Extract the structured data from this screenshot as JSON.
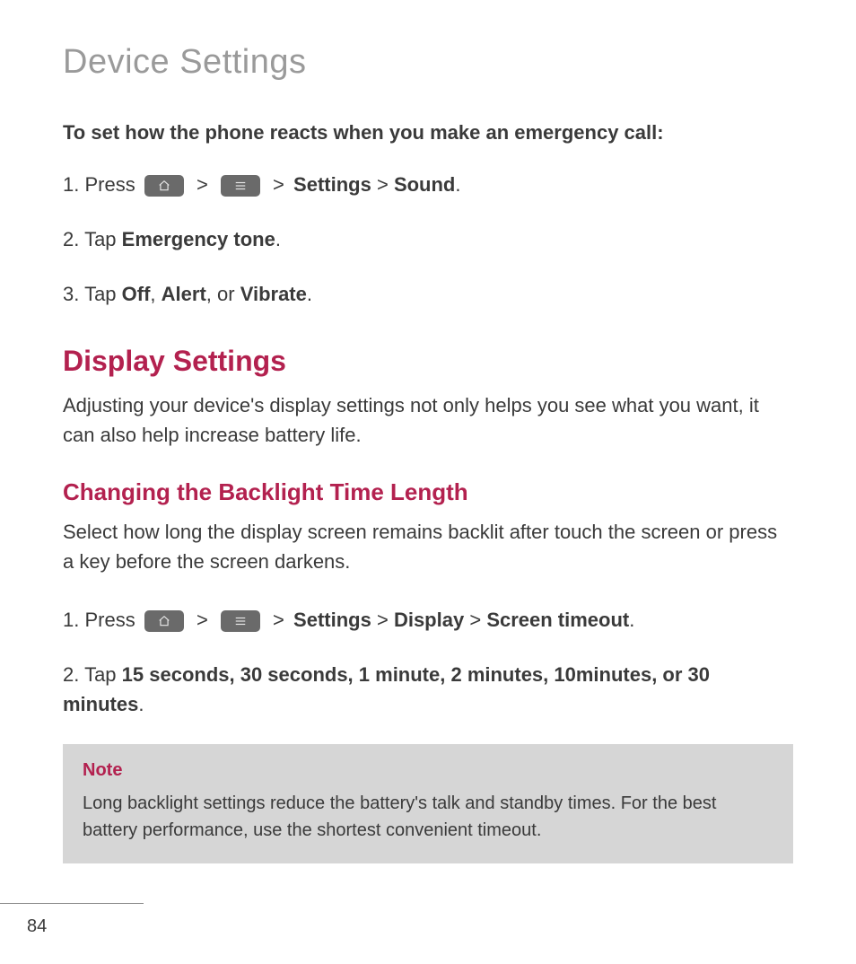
{
  "page": {
    "title": "Device Settings",
    "number": "84"
  },
  "intro": {
    "heading": "To set how the phone reacts when you make an emergency call:"
  },
  "steps1": {
    "s1_prefix": "1. Press ",
    "s1_gt1": ">",
    "s1_gt2": ">",
    "s1_settings": "Settings",
    "s1_gt3": ">",
    "s1_sound": "Sound",
    "s1_period": ".",
    "s2_prefix": "2. Tap ",
    "s2_bold": "Emergency tone",
    "s2_period": ".",
    "s3_prefix": "3. Tap ",
    "s3_off": "Off",
    "s3_comma1": ", ",
    "s3_alert": "Alert",
    "s3_comma2": ", or ",
    "s3_vibrate": "Vibrate",
    "s3_period": "."
  },
  "display": {
    "heading": "Display Settings",
    "para": "Adjusting your device's display settings not only helps you see what you want, it can also help increase battery life."
  },
  "backlight": {
    "heading": "Changing the Backlight Time Length",
    "para": "Select how long the display screen remains backlit after touch the screen or press a key before the screen darkens.",
    "s1_prefix": "1. Press ",
    "s1_gt1": ">",
    "s1_gt2": ">",
    "s1_settings": "Settings",
    "s1_gt3": ">",
    "s1_display": "Display",
    "s1_gt4": ">",
    "s1_timeout": "Screen timeout",
    "s1_period": ".",
    "s2_prefix": "2. Tap ",
    "s2_bold": "15 seconds, 30 seconds, 1 minute, 2 minutes, 10minutes, or 30 minutes",
    "s2_period": "."
  },
  "note": {
    "title": "Note",
    "body": "Long backlight settings reduce the battery's talk and standby times. For the best battery performance, use the shortest convenient timeout."
  }
}
